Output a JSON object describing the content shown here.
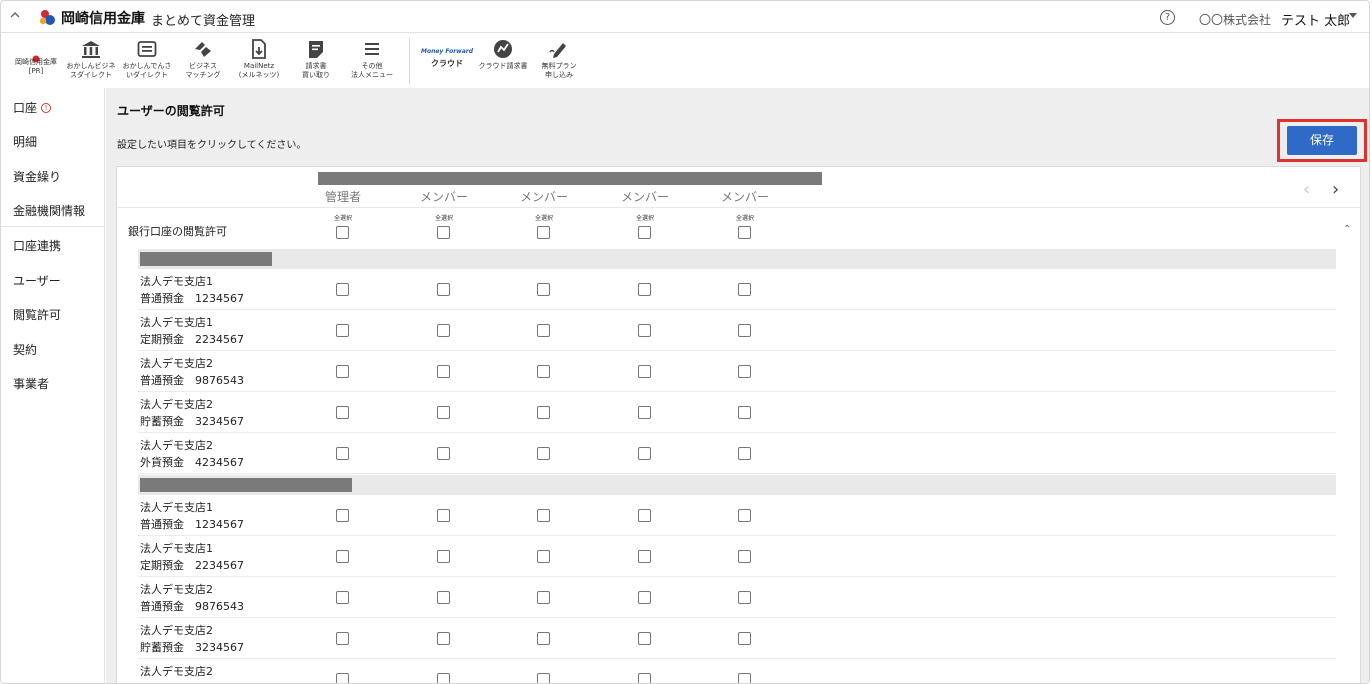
{
  "header": {
    "brand": "岡崎信用金庫",
    "subtitle": "まとめて資金管理",
    "company": "〇〇株式会社",
    "user": "テスト 太郎"
  },
  "toolbar": [
    {
      "label": "岡崎信用金庫\n[PR]",
      "icon": "bank-logo-icon"
    },
    {
      "label": "おかしんビジネ\nスダイレクト",
      "icon": "bank-building-icon"
    },
    {
      "label": "おかしんでんさ\nいダイレクト",
      "icon": "list-card-icon"
    },
    {
      "label": "ビジネス\nマッチング",
      "icon": "handshake-icon"
    },
    {
      "label": "MailNetz\n(メルネッツ)",
      "icon": "document-download-icon"
    },
    {
      "label": "請求書\n買い取り",
      "icon": "invoice-icon"
    },
    {
      "label": "その他\n法人メニュー",
      "icon": "menu-lines-icon"
    },
    {
      "label": "クラウド",
      "icon": "moneyforward-logo",
      "logo_text": "Money Forward"
    },
    {
      "label": "クラウド請求書",
      "icon": "cloud-invoice-icon"
    },
    {
      "label": "無料プラン\n申し込み",
      "icon": "signup-pen-icon"
    }
  ],
  "sidebar": {
    "items": [
      "口座",
      "明細",
      "資金繰り",
      "金融機関情報",
      "口座連携",
      "ユーザー",
      "閲覧許可",
      "契約",
      "事業者"
    ]
  },
  "main": {
    "title": "ユーザーの閲覧許可",
    "description": "設定したい項目をクリックしてください。",
    "save_label": "保存",
    "columns": [
      "管理者",
      "メンバー",
      "メンバー",
      "メンバー",
      "メンバー"
    ],
    "select_all_label": "全選択",
    "section_label": "銀行口座の閲覧許可",
    "groups": [
      {
        "rows": [
          {
            "branch": "法人デモ支店1",
            "account": "普通預金　1234567"
          },
          {
            "branch": "法人デモ支店1",
            "account": "定期預金　2234567"
          },
          {
            "branch": "法人デモ支店2",
            "account": "普通預金　9876543"
          },
          {
            "branch": "法人デモ支店2",
            "account": "貯蓄預金　3234567"
          },
          {
            "branch": "法人デモ支店2",
            "account": "外貨預金　4234567"
          }
        ]
      },
      {
        "rows": [
          {
            "branch": "法人デモ支店1",
            "account": "普通預金　1234567"
          },
          {
            "branch": "法人デモ支店1",
            "account": "定期預金　2234567"
          },
          {
            "branch": "法人デモ支店2",
            "account": "普通預金　9876543"
          },
          {
            "branch": "法人デモ支店2",
            "account": "貯蓄預金　3234567"
          },
          {
            "branch": "法人デモ支店2",
            "account": ""
          }
        ]
      }
    ]
  },
  "colors": {
    "accent": "#2f6ac6",
    "highlight": "#e0312b",
    "background": "#eeeeee"
  }
}
